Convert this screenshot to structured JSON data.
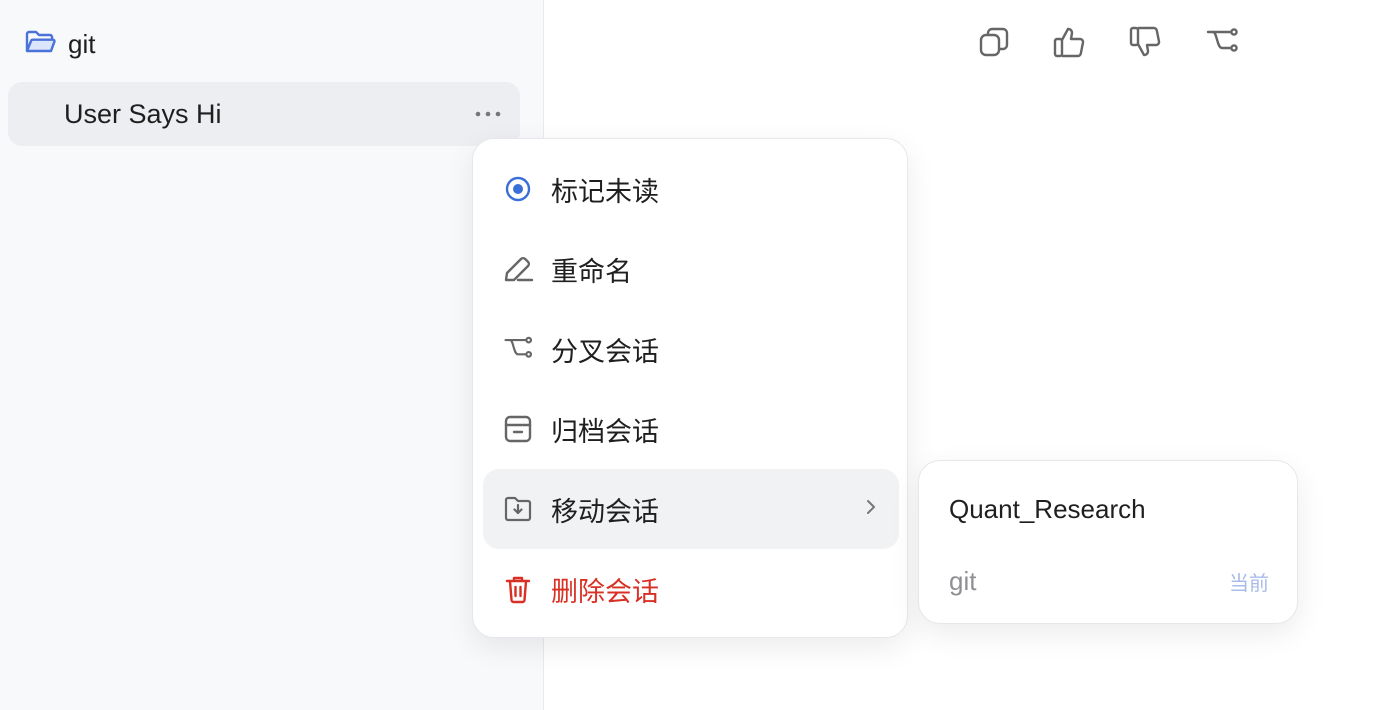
{
  "sidebar": {
    "folder": {
      "label": "git",
      "icon": "folder-open-icon"
    },
    "conversation": {
      "title": "User Says Hi",
      "more_icon": "more-horizontal-icon"
    }
  },
  "toolbar": {
    "icons": [
      "copy-icon",
      "thumbs-up-icon",
      "thumbs-down-icon",
      "fork-icon"
    ]
  },
  "context_menu": {
    "items": [
      {
        "label": "标记未读",
        "icon": "mark-unread-icon"
      },
      {
        "label": "重命名",
        "icon": "rename-pencil-icon"
      },
      {
        "label": "分叉会话",
        "icon": "fork-icon"
      },
      {
        "label": "归档会话",
        "icon": "archive-icon"
      },
      {
        "label": "移动会话",
        "icon": "move-folder-icon"
      },
      {
        "label": "删除会话",
        "icon": "trash-icon"
      }
    ]
  },
  "move_submenu": {
    "items": [
      {
        "label": "Quant_Research"
      },
      {
        "label": "git",
        "badge": "当前"
      }
    ]
  },
  "colors": {
    "accent": "#3b6fd8",
    "danger": "#d93025",
    "current_badge": "#a8bce9"
  }
}
